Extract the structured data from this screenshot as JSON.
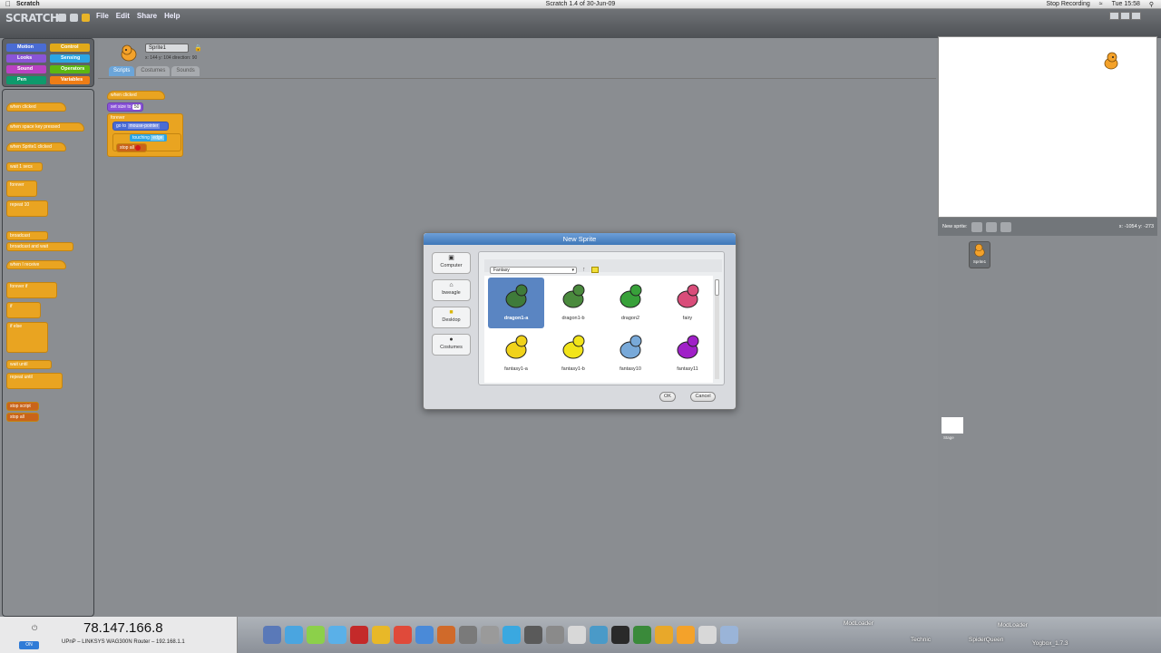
{
  "menubar": {
    "app_name": "Scratch",
    "window_title": "Scratch 1.4 of 30-Jun-09",
    "stop_recording": "Stop Recording",
    "time": "Tue 15:58"
  },
  "scratch": {
    "logo": "SCRATCH",
    "menus": [
      "File",
      "Edit",
      "Share",
      "Help"
    ],
    "categories": [
      {
        "label": "Motion",
        "color": "#4a6cd4"
      },
      {
        "label": "Control",
        "color": "#e1a91a"
      },
      {
        "label": "Looks",
        "color": "#8a55d7"
      },
      {
        "label": "Sensing",
        "color": "#2ca5e2"
      },
      {
        "label": "Sound",
        "color": "#bb42c3"
      },
      {
        "label": "Operators",
        "color": "#5cb712"
      },
      {
        "label": "Pen",
        "color": "#0e9a6c"
      },
      {
        "label": "Variables",
        "color": "#ee7d16"
      }
    ],
    "palette_blocks": [
      "when clicked",
      "when space key pressed",
      "when Sprite1 clicked",
      "wait 1 secs",
      "forever",
      "repeat 10",
      "broadcast",
      "broadcast and wait",
      "when I receive",
      "forever if",
      "if",
      "if else",
      "wait until",
      "repeat until",
      "stop script",
      "stop all"
    ],
    "sprite": {
      "name": "Sprite1",
      "coords": "x: 144  y: 104  direction: 90"
    },
    "tabs": [
      "Scripts",
      "Costumes",
      "Sounds"
    ],
    "script_blocks": {
      "hat": "when clicked",
      "set_size": "set size to",
      "set_size_val": "50",
      "forever": "forever",
      "goto": "go to",
      "goto_val": "mouse-pointer",
      "if_touching": "touching",
      "touching_val": "edge",
      "stop_all": "stop all"
    },
    "stage_bar": {
      "new_sprite": "New sprite:",
      "xy": "x: -1054  y: -273"
    },
    "sprite_tile_label": "Sprite1",
    "stage_label": "Stage"
  },
  "dialog": {
    "title": "New Sprite",
    "sources": [
      "Computer",
      "bweagle",
      "Desktop",
      "Costumes"
    ],
    "folder": "Fantasy",
    "items": [
      {
        "label": "dragon1-a",
        "selected": true,
        "color": "#3f7b3a"
      },
      {
        "label": "dragon1-b",
        "selected": false,
        "color": "#4a8a3d"
      },
      {
        "label": "dragon2",
        "selected": false,
        "color": "#38a13a"
      },
      {
        "label": "fairy",
        "selected": false,
        "color": "#d94d7a"
      },
      {
        "label": "fantasy1-a",
        "selected": false,
        "color": "#f0d21a"
      },
      {
        "label": "fantasy1-b",
        "selected": false,
        "color": "#f2e41a"
      },
      {
        "label": "fantasy10",
        "selected": false,
        "color": "#78a9d9"
      },
      {
        "label": "fantasy11",
        "selected": false,
        "color": "#a020c8"
      }
    ],
    "ok": "OK",
    "cancel": "Cancel"
  },
  "bottom": {
    "ip": "78.147.166.8",
    "on_label": "ON",
    "router": "UPnP – LINKSYS WAG300N Router – 192.168.1.1",
    "dock_labels": [
      "ModLoader",
      "Technic",
      "SpiderQueen",
      "ModLoader",
      "Yogbox_1.7.3"
    ]
  }
}
